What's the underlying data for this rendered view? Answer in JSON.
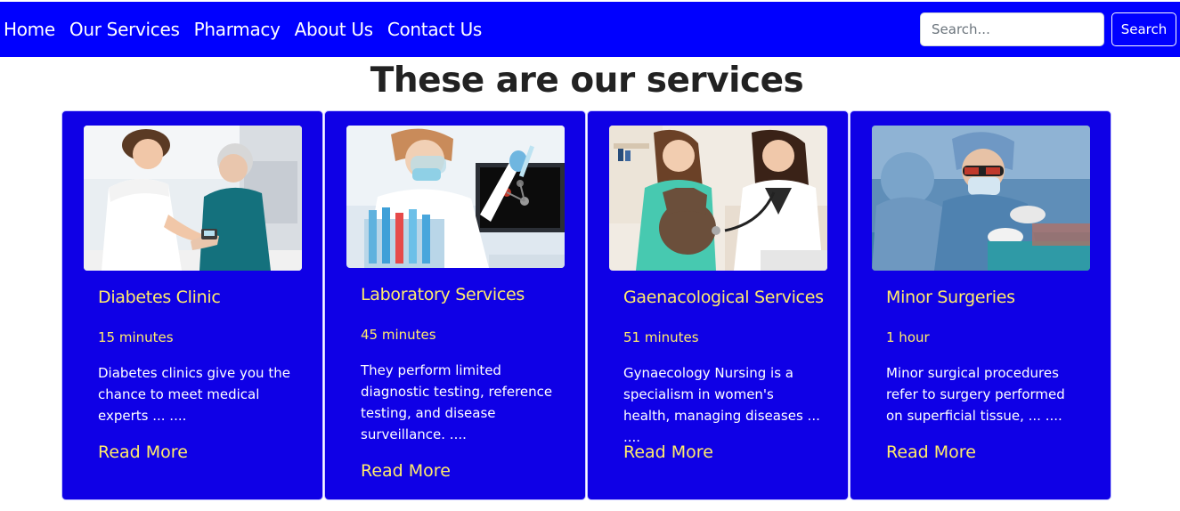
{
  "nav": {
    "links": [
      "Home",
      "Our Services",
      "Pharmacy",
      "About Us",
      "Contact Us"
    ],
    "search_placeholder": "Search...",
    "search_button": "Search"
  },
  "page": {
    "title": "These are our services"
  },
  "cards": [
    {
      "title": "Diabetes Clinic",
      "duration": "15 minutes",
      "description": "Diabetes clinics give you the chance to meet medical experts ... ....",
      "link": "Read More",
      "image": "nurse-checking-elderly-patient-glucose"
    },
    {
      "title": "Laboratory Services",
      "duration": "45 minutes",
      "description": "They perform limited diagnostic testing, reference testing, and disease surveillance. ....",
      "link": "Read More",
      "image": "lab-scientist-with-test-tubes"
    },
    {
      "title": "Gaenacological Services",
      "duration": "51 minutes",
      "description": "Gynaecology Nursing is a specialism in women's health, managing diseases ... ....",
      "link": "Read More",
      "image": "doctor-examining-pregnant-woman"
    },
    {
      "title": "Minor Surgeries",
      "duration": "1 hour",
      "description": "Minor surgical procedures refer to surgery performed on superficial tissue, ... ....",
      "link": "Read More",
      "image": "surgeons-in-operating-room"
    }
  ],
  "colors": {
    "navbar": "#0000ff",
    "card": "#0f00e6",
    "accent_text": "#ffeb6b",
    "body_text": "#ffffff"
  }
}
